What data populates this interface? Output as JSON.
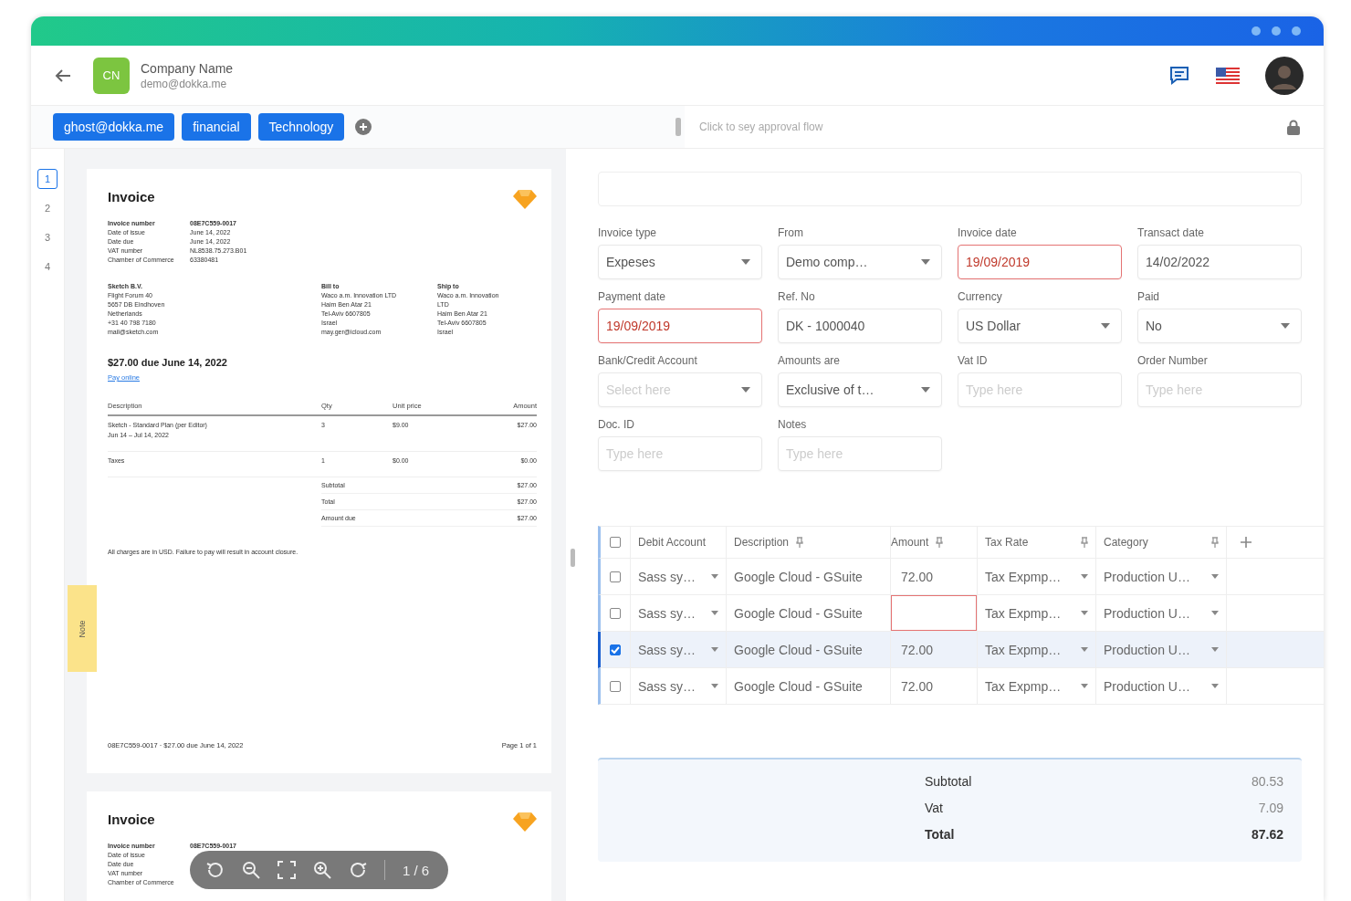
{
  "company": {
    "initials": "CN",
    "name": "Company Name",
    "email": "demo@dokka.me"
  },
  "tags": [
    "ghost@dokka.me",
    "financial",
    "Technology"
  ],
  "approval": {
    "placeholder": "Click to sey approval flow"
  },
  "pages": [
    {
      "label": "1",
      "selected": true
    },
    {
      "label": "2",
      "selected": false
    },
    {
      "label": "3",
      "selected": false
    },
    {
      "label": "4",
      "selected": false
    }
  ],
  "note_tab": "Note",
  "invoice": {
    "title": "Invoice",
    "meta": [
      {
        "label": "Invoice number",
        "value": "08E7C559-0017"
      },
      {
        "label": "Date of issue",
        "value": "June 14, 2022"
      },
      {
        "label": "Date due",
        "value": "June 14, 2022"
      },
      {
        "label": "VAT number",
        "value": "NL8538.75.273.B01"
      },
      {
        "label": "Chamber of Commerce",
        "value": "63380481"
      }
    ],
    "from": [
      "Sketch B.V.",
      "Flight Forum 40",
      "5657 DB Eindhoven",
      "Netherlands",
      "+31 40 798 7180",
      "mail@sketch.com"
    ],
    "bill_to": [
      "Bill to",
      "Waco a.m. Innovation LTD",
      "Haim Ben Atar 21",
      "Tel-Aviv 6607805",
      "Israel",
      "may.ger@icloud.com"
    ],
    "ship_to": [
      "Ship to",
      "Waco a.m. Innovation",
      "LTD",
      "Haim Ben Atar 21",
      "Tel-Aviv 6607805",
      "Israel"
    ],
    "due": "$27.00 due June 14, 2022",
    "pay_link": "Pay online",
    "columns": [
      "Description",
      "Qty",
      "Unit price",
      "Amount"
    ],
    "items": [
      {
        "description": "Sketch - Standard Plan (per Editor)",
        "period": "Jun 14 – Jul 14, 2022",
        "qty": "3",
        "unit_price": "$9.00",
        "amount": "$27.00"
      },
      {
        "description": "Taxes",
        "qty": "1",
        "unit_price": "$0.00",
        "amount": "$0.00"
      }
    ],
    "summary": [
      {
        "label": "Subtotal",
        "value": "$27.00"
      },
      {
        "label": "Total",
        "value": "$27.00"
      },
      {
        "label": "Amount due",
        "value": "$27.00"
      }
    ],
    "note": "All charges are in USD. Failure to pay will result in account closure.",
    "footer_left": "08E7C559-0017 · $27.00 due June 14, 2022",
    "footer_right": "Page 1 of 1"
  },
  "invoice_page_2": {
    "title": "Invoice",
    "meta": [
      {
        "label": "Invoice number",
        "value": "08E7C559-0017"
      },
      {
        "label": "Date of issue"
      },
      {
        "label": "Date due"
      },
      {
        "label": "VAT number"
      },
      {
        "label": "Chamber of Commerce"
      }
    ]
  },
  "viewer_toolbar": {
    "page_indicator": "1 / 6"
  },
  "fields": [
    {
      "label": "Invoice type",
      "kind": "select",
      "value": "Expeses",
      "error": false
    },
    {
      "label": "From",
      "kind": "select",
      "value": "Demo comp…",
      "error": false
    },
    {
      "label": "Invoice date",
      "kind": "text",
      "value": "19/09/2019",
      "error": true
    },
    {
      "label": "Transact date",
      "kind": "text",
      "value": "14/02/2022",
      "error": false
    },
    {
      "label": "Payment date",
      "kind": "text",
      "value": "19/09/2019",
      "error": true
    },
    {
      "label": "Ref. No",
      "kind": "text",
      "value": "DK - 1000040",
      "error": false
    },
    {
      "label": "Currency",
      "kind": "select",
      "value": "US Dollar",
      "error": false
    },
    {
      "label": "Paid",
      "kind": "select",
      "value": "No",
      "error": false
    },
    {
      "label": "Bank/Credit Account",
      "kind": "select",
      "placeholder": "Select here",
      "error": false
    },
    {
      "label": "Amounts are",
      "kind": "select",
      "value": "Exclusive of t…",
      "error": false
    },
    {
      "label": "Vat ID",
      "kind": "text",
      "placeholder": "Type here",
      "error": false
    },
    {
      "label": "Order Number",
      "kind": "text",
      "placeholder": "Type here",
      "error": false
    },
    {
      "label": "Doc. ID",
      "kind": "text",
      "placeholder": "Type here",
      "error": false
    },
    {
      "label": "Notes",
      "kind": "text",
      "placeholder": "Type here",
      "error": false
    }
  ],
  "table": {
    "all_checked": false,
    "columns": [
      {
        "label": "Debit Account",
        "pinned": false
      },
      {
        "label": "Description",
        "pinned": true
      },
      {
        "label": "Amount",
        "pinned": true
      },
      {
        "label": "Tax Rate",
        "pinned": true
      },
      {
        "label": "Category",
        "pinned": true
      }
    ],
    "rows": [
      {
        "selected": false,
        "checked": false,
        "debit_account": "Sass sy…",
        "description": "Google Cloud - GSuite",
        "amount": "72.00",
        "amount_error": false,
        "tax_rate": "Tax Expmp…",
        "category": "Production U…"
      },
      {
        "selected": false,
        "checked": false,
        "debit_account": "Sass sy…",
        "description": "Google Cloud - GSuite",
        "amount_error": true,
        "tax_rate": "Tax Expmp…",
        "category": "Production U…"
      },
      {
        "selected": true,
        "checked": true,
        "debit_account": "Sass sy…",
        "description": "Google Cloud - GSuite",
        "amount": "72.00",
        "amount_error": false,
        "tax_rate": "Tax Expmp…",
        "category": "Production U…"
      },
      {
        "selected": false,
        "checked": false,
        "debit_account": "Sass sy…",
        "description": "Google Cloud - GSuite",
        "amount": "72.00",
        "amount_error": false,
        "tax_rate": "Tax Expmp…",
        "category": "Production U…"
      }
    ]
  },
  "totals": [
    {
      "label": "Subtotal",
      "value": "80.53",
      "emphasis": false
    },
    {
      "label": "Vat",
      "value": "7.09",
      "emphasis": false
    },
    {
      "label": "Total",
      "value": "87.62",
      "emphasis": true
    }
  ]
}
